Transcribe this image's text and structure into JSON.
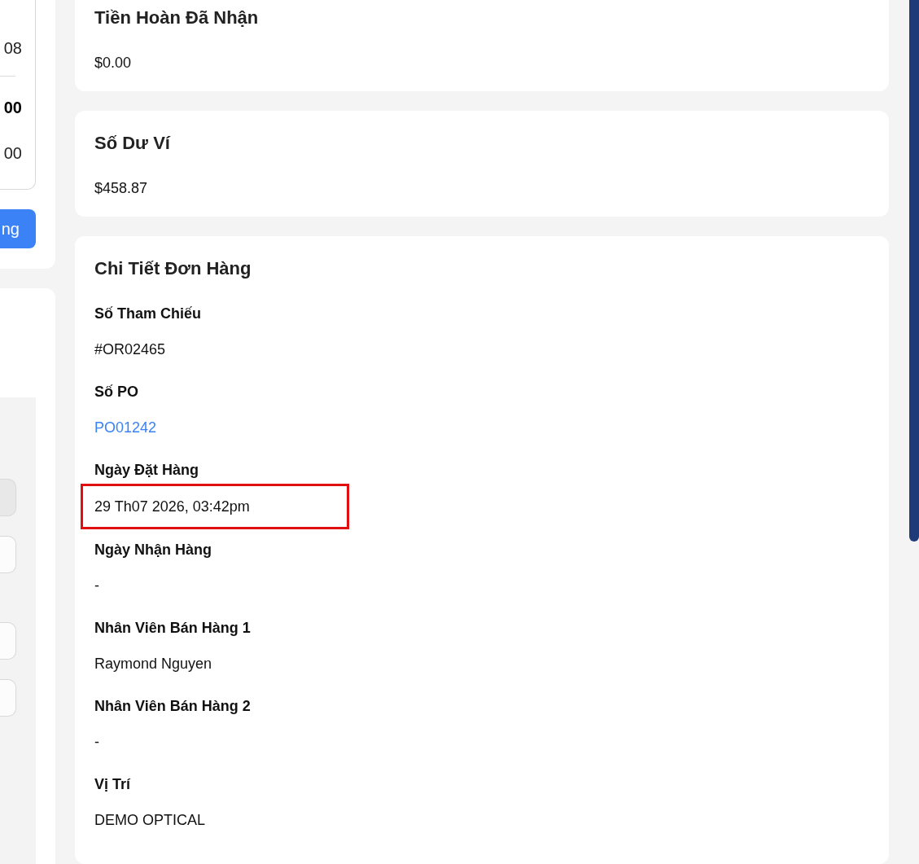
{
  "summary_panel": {
    "rows": [
      {
        "kind": "plain",
        "value": "08"
      },
      {
        "kind": "total",
        "value": "00"
      },
      {
        "kind": "plain",
        "value": "00"
      }
    ],
    "button": "ng"
  },
  "form_panel": {
    "fields": [
      {
        "kind": "disabled"
      },
      {
        "kind": "input"
      },
      {
        "kind": "gap"
      },
      {
        "kind": "input"
      },
      {
        "kind": "input"
      }
    ]
  },
  "refund_card": {
    "title": "Tiền Hoàn Đã Nhận",
    "value": "$0.00"
  },
  "wallet_card": {
    "title": "Số Dư Ví",
    "value": "$458.87"
  },
  "order_details": {
    "title": "Chi Tiết Đơn Hàng",
    "fields": [
      {
        "label": "Số Tham Chiếu",
        "value": "#OR02465",
        "kind": "text",
        "highlighted": false
      },
      {
        "label": "Số PO",
        "value": "PO01242",
        "kind": "link",
        "highlighted": false
      },
      {
        "label": "Ngày Đặt Hàng",
        "value": "29 Th07 2026, 03:42pm",
        "kind": "text",
        "highlighted": true
      },
      {
        "label": "Ngày Nhận Hàng",
        "value": "-",
        "kind": "text",
        "highlighted": false
      },
      {
        "label": "Nhân Viên Bán Hàng 1",
        "value": "Raymond Nguyen",
        "kind": "text",
        "highlighted": false
      },
      {
        "label": "Nhân Viên Bán Hàng 2",
        "value": "-",
        "kind": "text",
        "highlighted": false
      },
      {
        "label": "Vị Trí",
        "value": "DEMO OPTICAL",
        "kind": "text",
        "highlighted": false
      }
    ]
  }
}
